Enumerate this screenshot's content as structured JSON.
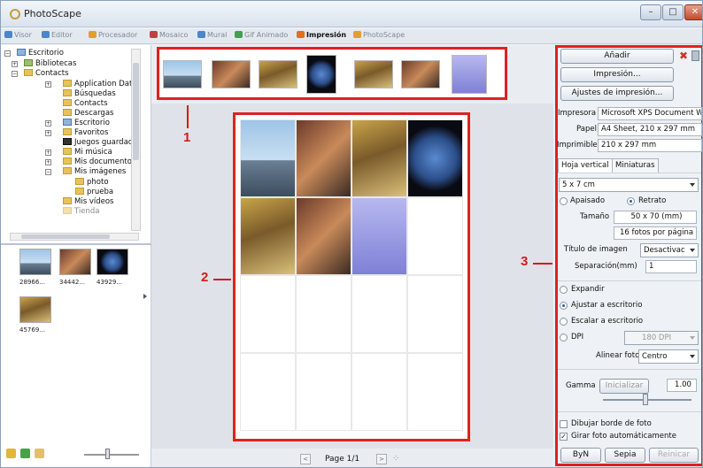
{
  "app": {
    "title": "PhotoScape"
  },
  "tabs": [
    {
      "label": "Visor",
      "color": "#4a86c8"
    },
    {
      "label": "Editor",
      "color": "#4a86c8"
    },
    {
      "label": "Procesador",
      "color": "#e0a030"
    },
    {
      "label": "Mosaico",
      "color": "#c04040"
    },
    {
      "label": "Mural",
      "color": "#4a86c8"
    },
    {
      "label": "Gif Animado",
      "color": "#40a050"
    },
    {
      "label": "Impresión",
      "color": "#e07020",
      "active": true
    },
    {
      "label": "PhotoScape",
      "color": "#e0a030"
    }
  ],
  "tree": [
    {
      "label": "Escritorio"
    },
    {
      "label": "Bibliotecas"
    },
    {
      "label": "Contacts"
    },
    {
      "label": "Application Dat"
    },
    {
      "label": "Búsquedas"
    },
    {
      "label": "Contacts"
    },
    {
      "label": "Descargas"
    },
    {
      "label": "Escritorio"
    },
    {
      "label": "Favoritos"
    },
    {
      "label": "Juegos guardac"
    },
    {
      "label": "Mi música"
    },
    {
      "label": "Mis documento"
    },
    {
      "label": "Mis imágenes"
    },
    {
      "label": "photo"
    },
    {
      "label": "prueba"
    },
    {
      "label": "Mis vídeos"
    },
    {
      "label": "Tienda"
    }
  ],
  "left_thumbs": [
    {
      "label": "28966..."
    },
    {
      "label": "34442..."
    },
    {
      "label": "43929..."
    },
    {
      "label": "45769..."
    }
  ],
  "page_nav": {
    "label": "Page 1/1",
    "prev": "<",
    "next": ">"
  },
  "callouts": [
    "1",
    "2",
    "3"
  ],
  "right": {
    "add": "Añadir",
    "print": "Impresión...",
    "print_settings": "Ajustes de impresión...",
    "printer_label": "Impresora",
    "printer_value": "Microsoft XPS Document W",
    "paper_label": "Papel",
    "paper_value": "A4 Sheet, 210 x 297 mm",
    "printable_label": "Imprimible",
    "printable_value": "210 x 297 mm",
    "tab_sheet": "Hoja vertical",
    "tab_thumbs": "Miniaturas",
    "size_combo": "5 x 7 cm",
    "landscape": "Apaisado",
    "portrait": "Retrato",
    "size_label": "Tamaño",
    "size_value": "50 x 70 (mm)",
    "photos_per_page": "16 fotos por página",
    "title_label": "Título de imagen",
    "title_value": "Desactivac",
    "spacing_label": "Separación(mm)",
    "spacing_value": "1",
    "expand": "Expandir",
    "fit_desktop": "Ajustar a escritorio",
    "scale_desktop": "Escalar a escritorio",
    "dpi": "DPI",
    "dpi_value": "180 DPI",
    "align_label": "Alinear foto",
    "align_value": "Centro",
    "gamma_label": "Gamma",
    "gamma_init": "Inicializar",
    "gamma_value": "1.00",
    "draw_border": "Dibujar borde de foto",
    "auto_rotate": "Girar foto automáticamente",
    "bw": "ByN",
    "sepia": "Sepia",
    "reset": "Reinicar"
  }
}
